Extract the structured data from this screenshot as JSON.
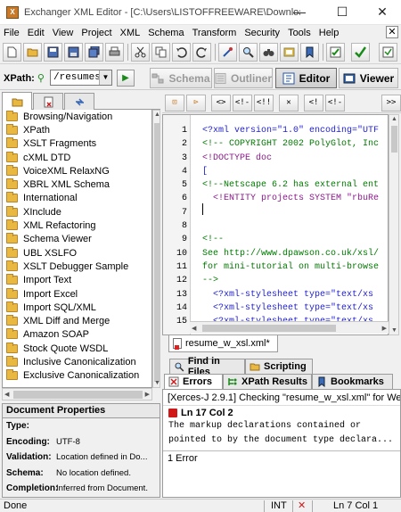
{
  "window": {
    "title": "Exchanger XML Editor - [C:\\Users\\LISTOFFREEWARE\\Downloads\\X...",
    "minimize_glyph": "—",
    "maximize_glyph": "☐",
    "close_glyph": "✕",
    "app_icon_letter": "X"
  },
  "menu": {
    "items": [
      "File",
      "Edit",
      "View",
      "Project",
      "XML",
      "Schema",
      "Transform",
      "Security",
      "Tools",
      "Help"
    ],
    "close_glyph": "✕"
  },
  "xpath": {
    "label": "XPath:",
    "value": "/resumes",
    "run_glyph": "▶",
    "dropdown_glyph": "▼"
  },
  "views": {
    "schema": "Schema",
    "outliner": "Outliner",
    "editor": "Editor",
    "viewer": "Viewer"
  },
  "tree": {
    "items": [
      "Browsing/Navigation",
      "XPath",
      "XSLT Fragments",
      "cXML DTD",
      "VoiceXML RelaxNG",
      "XBRL XML Schema",
      "International",
      "XInclude",
      "XML Refactoring",
      "Schema Viewer",
      "UBL XSLFO",
      "XSLT Debugger Sample",
      "Import Text",
      "Import Excel",
      "Import SQL/XML",
      "XML Diff and Merge",
      "Amazon SOAP",
      "Stock Quote WSDL",
      "Inclusive Canonicalization",
      "Exclusive Canonicalization"
    ]
  },
  "doc_properties": {
    "title": "Document Properties",
    "rows": [
      {
        "key": "Type:",
        "value": ""
      },
      {
        "key": "Encoding:",
        "value": "UTF-8"
      },
      {
        "key": "Validation:",
        "value": "Location defined in Do..."
      },
      {
        "key": "Schema:",
        "value": "No location defined."
      },
      {
        "key": "Completion:",
        "value": "Inferred from Document."
      }
    ]
  },
  "editor_toolbar": {
    "buttons": [
      "⊡",
      "⊳",
      "<>",
      "<!-",
      "<!!",
      "✕",
      "<!",
      "<!-",
      ">>"
    ]
  },
  "editor": {
    "line_numbers": [
      "1",
      "2",
      "3",
      "4",
      "5",
      "6",
      "7",
      "8",
      "9",
      "10",
      "11",
      "12",
      "13",
      "14",
      "15"
    ],
    "lines": [
      "<?xml version=\"1.0\" encoding=\"UTF",
      "<!-- COPYRIGHT 2002 PolyGlot, Inc",
      "<!DOCTYPE doc",
      "[",
      "<!--Netscape 6.2 has external ent",
      "  <!ENTITY projects SYSTEM \"rbuRe",
      "",
      "",
      "<!--",
      "See http://www.dpawson.co.uk/xsl/",
      "for mini-tutorial on multi-browse",
      "-->",
      "  <?xml-stylesheet type=\"text/xs",
      "  <?xml-stylesheet type=\"text/xs",
      "  <?xml-stylesheet type=\"text/xs"
    ],
    "tab_label": "resume_w_xsl.xml*"
  },
  "bottom": {
    "tab_find": "Find in Files",
    "tab_scripting": "Scripting",
    "tab_errors": "Errors",
    "tab_xpath": "XPath Results",
    "tab_bookmarks": "Bookmarks",
    "error_header": "[Xerces-J 2.9.1] Checking \"resume_w_xsl.xml\" for We...",
    "error_location": "Ln 17 Col 2",
    "error_line1": "The markup declarations contained or",
    "error_line2": "pointed to by the document type declara...",
    "error_count": "1 Error"
  },
  "status": {
    "left": "Done",
    "mode": "INT",
    "error_glyph": "✕",
    "position": "Ln 7 Col 1"
  },
  "colors": {
    "accent_green": "#1a8a1a",
    "error_red": "#d01818",
    "xml_pi": "#2222cc",
    "xml_comment": "#007a00"
  }
}
